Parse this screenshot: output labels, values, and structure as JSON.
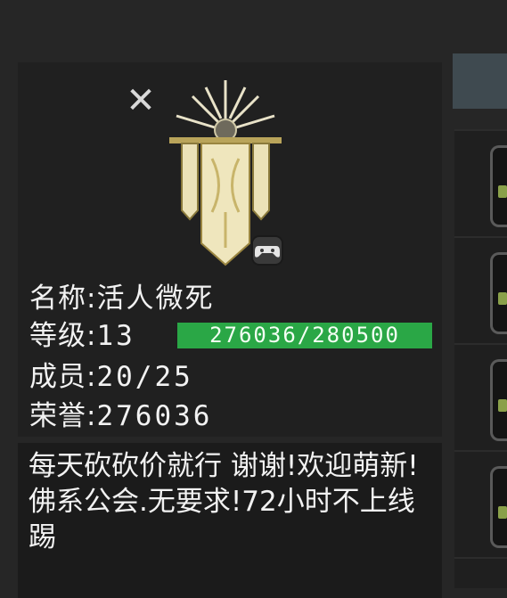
{
  "guild": {
    "close_icon": "close-icon",
    "emblem_icon": "guild-banner-emblem",
    "badge_icon": "gamepad-icon",
    "name_label": "名称:",
    "name_value": "活人微死",
    "level_label": "等级:",
    "level_value": "13",
    "xp_text": "276036/280500",
    "xp_current": 276036,
    "xp_max": 280500,
    "members_label": "成员:",
    "members_value": "20/25",
    "honor_label": "荣誉:",
    "honor_value": "276036",
    "description": "每天砍砍价就行 谢谢!欢迎萌新!佛系公会.无要求!72小时不上线踢"
  },
  "colors": {
    "xp_bar": "#2aa746",
    "panel_bg": "#202020",
    "page_bg": "#262626"
  }
}
